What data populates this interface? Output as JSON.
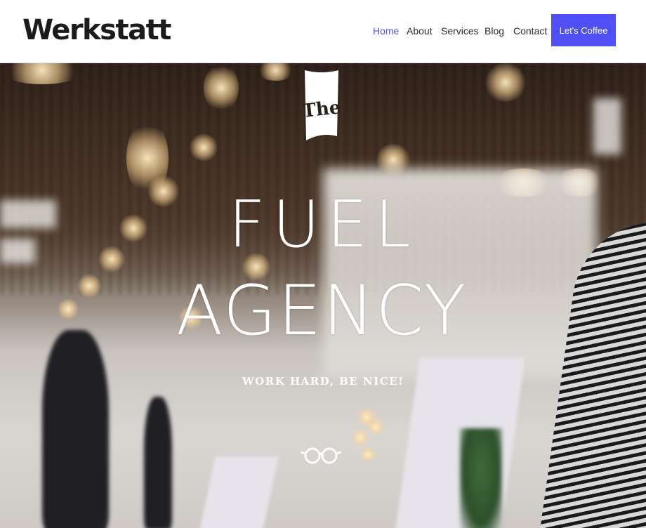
{
  "header": {
    "logo": "Werkstatt",
    "nav": [
      {
        "label": "Home",
        "active": true
      },
      {
        "label": "About",
        "active": false
      },
      {
        "label": "Services",
        "active": false
      },
      {
        "label": "Blog",
        "active": false
      },
      {
        "label": "Contact",
        "active": false
      }
    ],
    "cta_label": "Let's Coffee"
  },
  "hero": {
    "badge_text": "The",
    "title_line1": "FUEL",
    "title_line2": "AGENCY",
    "tagline": "WORK HARD, BE NICE!",
    "icon": "glasses-icon"
  },
  "colors": {
    "accent": "#4f4ff5",
    "nav_active": "#4f55e8",
    "text_dark": "#1b1b1b",
    "hero_text": "#ffffff"
  }
}
